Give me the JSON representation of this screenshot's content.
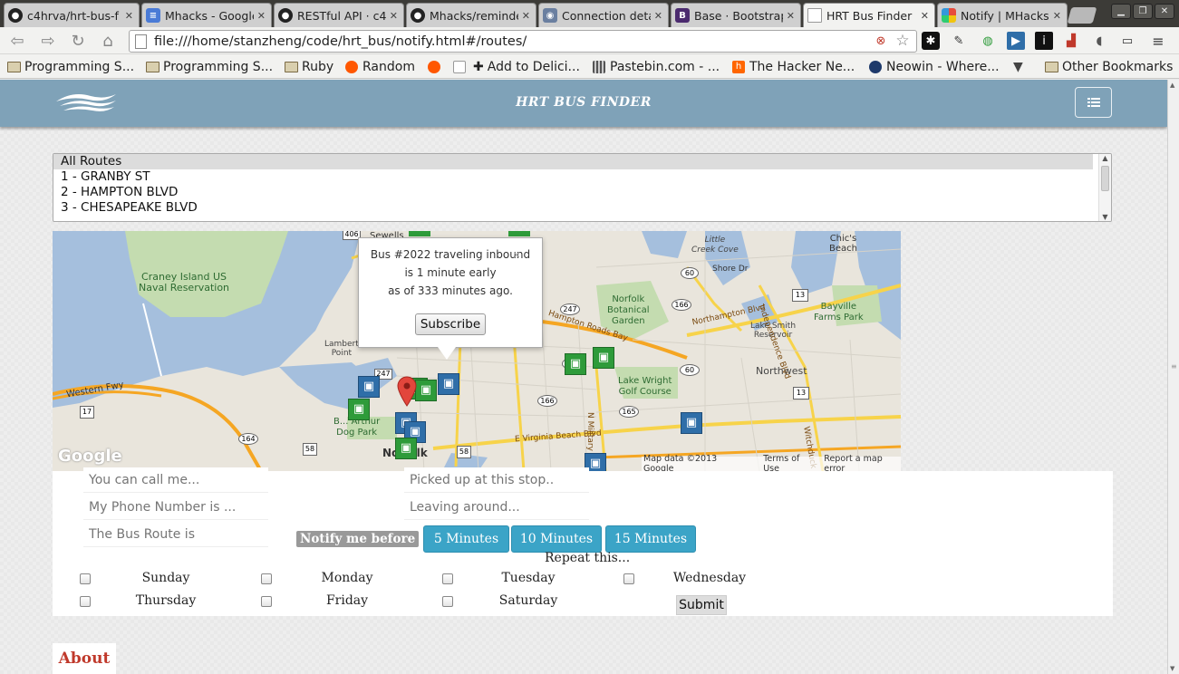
{
  "tabs": [
    {
      "label": "c4hrva/hrt-bus-f",
      "icon": "github-icon"
    },
    {
      "label": "Mhacks - Google",
      "icon": "google-docs-icon"
    },
    {
      "label": "RESTful API · c4h",
      "icon": "github-icon"
    },
    {
      "label": "Mhacks/reminde",
      "icon": "github-icon"
    },
    {
      "label": "Connection deta",
      "icon": "connection-icon"
    },
    {
      "label": "Base · Bootstrap",
      "icon": "bootstrap-icon"
    },
    {
      "label": "HRT Bus Finder",
      "icon": "page-icon"
    },
    {
      "label": "Notify | MHacks",
      "icon": "mhacks-icon"
    }
  ],
  "address_bar": {
    "url": "file:///home/stanzheng/code/hrt_bus/notify.html#/routes/"
  },
  "bookmarks": [
    {
      "label": "Programming S...",
      "icon": "folder-icon"
    },
    {
      "label": "Programming S...",
      "icon": "folder-icon"
    },
    {
      "label": "Ruby",
      "icon": "folder-icon"
    },
    {
      "label": "Random",
      "icon": "reddit-icon"
    },
    {
      "label": "",
      "icon": "reddit-alien-icon"
    },
    {
      "label": "",
      "icon": "page-icon"
    },
    {
      "label": "Add to Delici...",
      "icon": "plus-icon"
    },
    {
      "label": "Pastebin.com - ...",
      "icon": "pastebin-icon"
    },
    {
      "label": "The Hacker Ne...",
      "icon": "hackernews-icon"
    },
    {
      "label": "Neowin - Where...",
      "icon": "neowin-icon"
    },
    {
      "label": "Other Bookmarks",
      "icon": "folder-icon"
    }
  ],
  "app": {
    "brand": "HRT BUS FINDER",
    "routes": [
      "All Routes",
      "1 - GRANBY ST",
      "2 - HAMPTON BLVD",
      "3 - CHESAPEAKE BLVD"
    ],
    "selected_route": "All Routes"
  },
  "map": {
    "popup": {
      "line1": "Bus #2022 traveling inbound",
      "line2": "is 1 minute early",
      "line3": "as of 333 minutes ago.",
      "button": "Subscribe"
    },
    "labels": {
      "craney": "Craney Island US",
      "naval": "Naval Reservation",
      "sewells": "Sewells",
      "chics": "Chic's",
      "beach": "Beach",
      "little_creek": "Little",
      "creek_cove": "Creek Cove",
      "shore_dr": "Shore Dr",
      "norfolk_bot": "Norfolk",
      "botanical": "Botanical",
      "garden": "Garden",
      "bayville": "Bayville",
      "farms_park": "Farms Park",
      "lake_smith": "Lake Smith",
      "reservoir": "Reservoir",
      "northwest": "Northwest",
      "lake_wright": "Lake Wright",
      "golf_course": "Golf Course",
      "lamberts": "Lambert",
      "point": "Point",
      "western_fwy": "Western Fwy",
      "barthur": "B... Arthur",
      "dog_park": "Dog Park",
      "norfolk": "Norfolk",
      "hampton_rd": "Hampton Roads Bay",
      "northampton": "Northampton Blvd",
      "independence": "Independence Blvd",
      "virginia_beach": "E Virginia Beach Blvd",
      "n_military": "N Military Hwy",
      "witchduck": "Witchduck Rd",
      "map_data": "Map data ©2013 Google",
      "terms": "Terms of Use",
      "report": "Report a map error",
      "google": "Google"
    },
    "shields": [
      "406",
      "247",
      "60",
      "13",
      "166",
      "247",
      "194",
      "166",
      "13",
      "17",
      "164",
      "165",
      "58",
      "58",
      "60"
    ]
  },
  "form": {
    "name_placeholder": "You can call me...",
    "phone_placeholder": "My Phone Number is ...",
    "route_placeholder": "The Bus Route is",
    "stop_placeholder": "Picked up at this stop..",
    "time_placeholder": "Leaving around...",
    "notify_label": "Notify me before",
    "time_buttons": [
      "5 Minutes",
      "10 Minutes",
      "15 Minutes"
    ],
    "repeat_label": "Repeat this...",
    "days": [
      "Sunday",
      "Monday",
      "Tuesday",
      "Wednesday",
      "Thursday",
      "Friday",
      "Saturday"
    ],
    "submit": "Submit"
  },
  "footer": {
    "about": "About"
  },
  "colors": {
    "navbar": "#7fa2b8",
    "accent_button": "#3ba4c7",
    "about_text": "#c0392b",
    "bus_green": "#2e9b3a",
    "bus_blue": "#2f6ea8"
  }
}
